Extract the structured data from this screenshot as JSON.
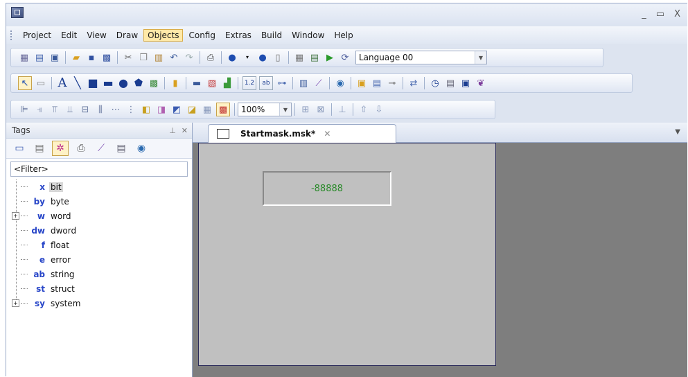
{
  "menubar": {
    "items": [
      {
        "label": "Project"
      },
      {
        "label": "Edit"
      },
      {
        "label": "View"
      },
      {
        "label": "Draw"
      },
      {
        "label": "Objects",
        "active": true
      },
      {
        "label": "Config"
      },
      {
        "label": "Extras"
      },
      {
        "label": "Build"
      },
      {
        "label": "Window"
      },
      {
        "label": "Help"
      }
    ]
  },
  "toolbar": {
    "language_value": "Language 00",
    "zoom_value": "100%"
  },
  "tags_pane": {
    "title": "Tags",
    "filter_placeholder": "<Filter>",
    "items": [
      {
        "abbr": "x",
        "label": "bit",
        "expandable": false,
        "selected": true
      },
      {
        "abbr": "by",
        "label": "byte",
        "expandable": false
      },
      {
        "abbr": "w",
        "label": "word",
        "expandable": true
      },
      {
        "abbr": "dw",
        "label": "dword",
        "expandable": false
      },
      {
        "abbr": "f",
        "label": "float",
        "expandable": false
      },
      {
        "abbr": "e",
        "label": "error",
        "expandable": false
      },
      {
        "abbr": "ab",
        "label": "string",
        "expandable": false
      },
      {
        "abbr": "st",
        "label": "struct",
        "expandable": false
      },
      {
        "abbr": "sy",
        "label": "system",
        "expandable": true
      }
    ]
  },
  "document": {
    "tab_title": "Startmask.msk*",
    "value_display": "-88888"
  },
  "colors": {
    "accent": "#ffe9a8",
    "canvas": "#c0c0c0",
    "workspace": "#7e7e7e",
    "value_text": "#2a8a2a",
    "tag_abbr": "#2846c8"
  }
}
